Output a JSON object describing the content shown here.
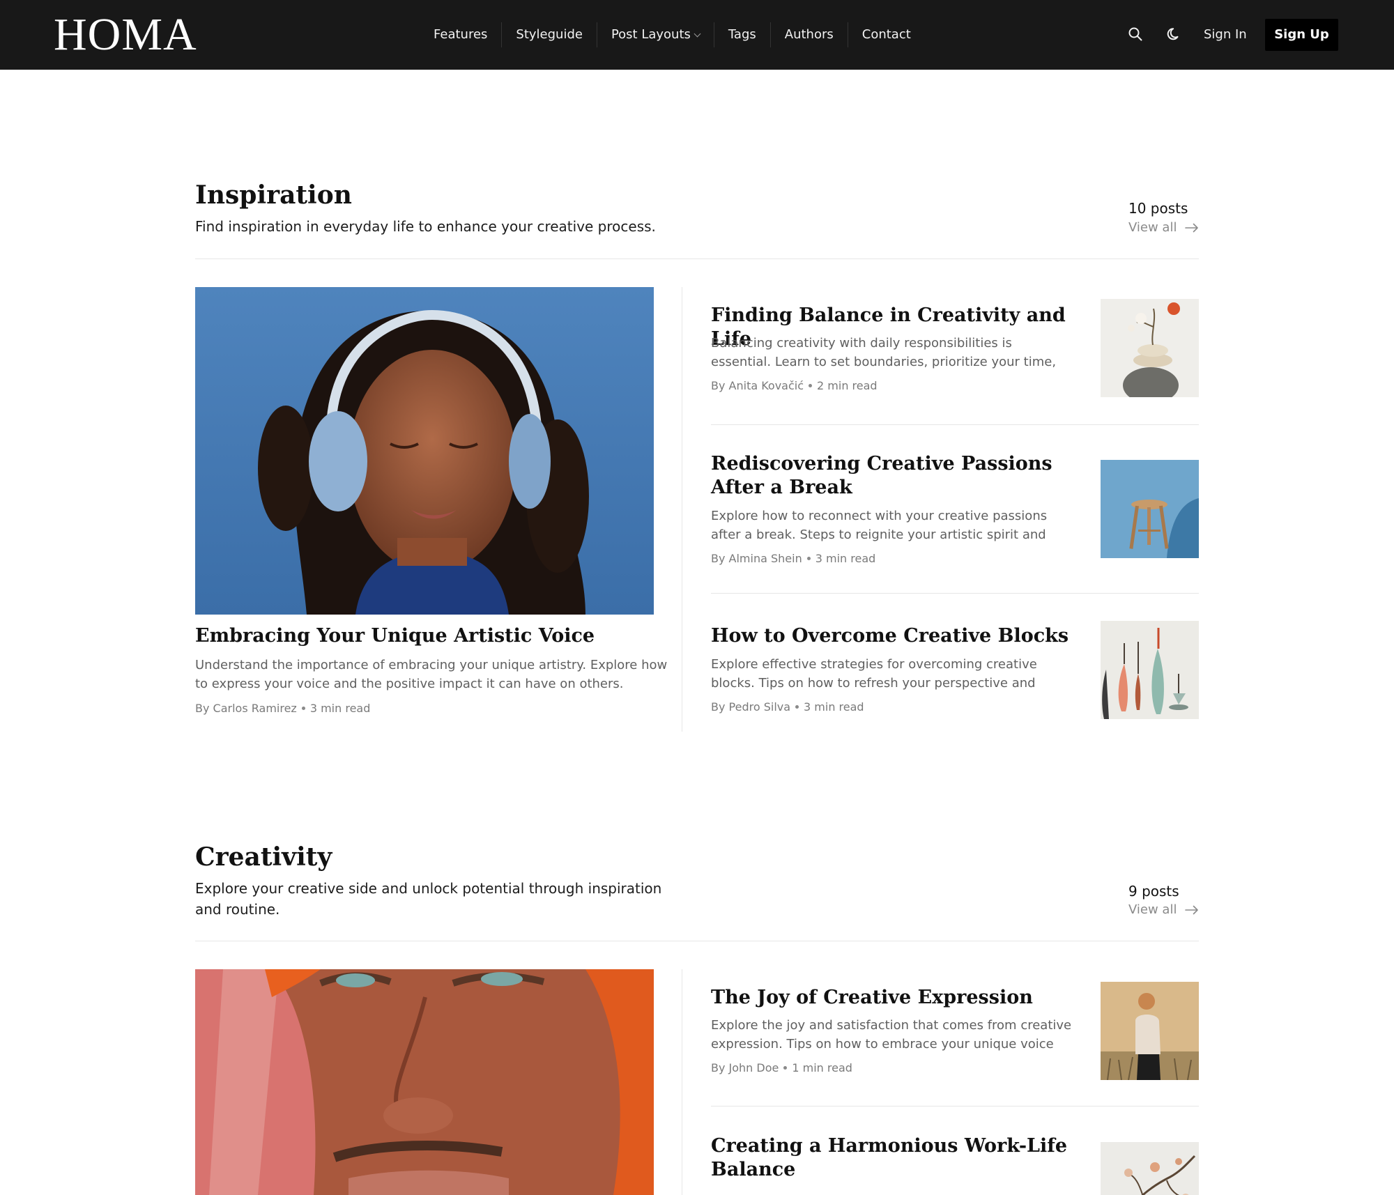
{
  "header": {
    "logo": "HOMA",
    "nav": [
      "Features",
      "Styleguide",
      "Post Layouts",
      "Tags",
      "Authors",
      "Contact"
    ],
    "sign_in": "Sign In",
    "sign_up": "Sign Up",
    "icons": [
      "search-icon",
      "moon-icon",
      "chevron-down-icon"
    ]
  },
  "sections": [
    {
      "title": "Inspiration",
      "description": "Find inspiration in everyday life to enhance your creative process.",
      "count": "10 posts",
      "view_all": "View all",
      "featured": {
        "title": "Embracing Your Unique Artistic Voice",
        "excerpt": "Understand the importance of embracing your unique artistry. Explore how to express your voice and the positive impact it can have on others.",
        "author": "By Carlos Ramirez",
        "read_time": "3 min read"
      },
      "posts": [
        {
          "title": "Finding Balance in Creativity and Life",
          "excerpt": "Balancing creativity with daily responsibilities is essential. Learn to set boundaries, prioritize your time, and embrace...",
          "author": "By Anita Kovačić",
          "read_time": "2 min read"
        },
        {
          "title": "Rediscovering Creative Passions After a Break",
          "excerpt": "Explore how to reconnect with your creative passions after a break. Steps to reignite your artistic spirit and enjoy the...",
          "author": "By Almina Shein",
          "read_time": "3 min read"
        },
        {
          "title": "How to Overcome Creative Blocks",
          "excerpt": "Explore effective strategies for overcoming creative blocks. Tips on how to refresh your perspective and reignite your...",
          "author": "By Pedro Silva",
          "read_time": "3 min read"
        }
      ]
    },
    {
      "title": "Creativity",
      "description": "Explore your creative side and unlock potential through inspiration and routine.",
      "count": "9 posts",
      "view_all": "View all",
      "posts": [
        {
          "title": "The Joy of Creative Expression",
          "excerpt": "Explore the joy and satisfaction that comes from creative expression. Tips on how to embrace your unique voice and...",
          "author": "By John Doe",
          "read_time": "1 min read"
        },
        {
          "title": "Creating a Harmonious Work-Life Balance"
        }
      ]
    }
  ],
  "colors": {
    "header_bg": "#181818",
    "signup_bg": "#000000",
    "muted_text": "#5f5f5f",
    "meta_text": "#7a7a7a",
    "rule": "#e6e6e6"
  }
}
